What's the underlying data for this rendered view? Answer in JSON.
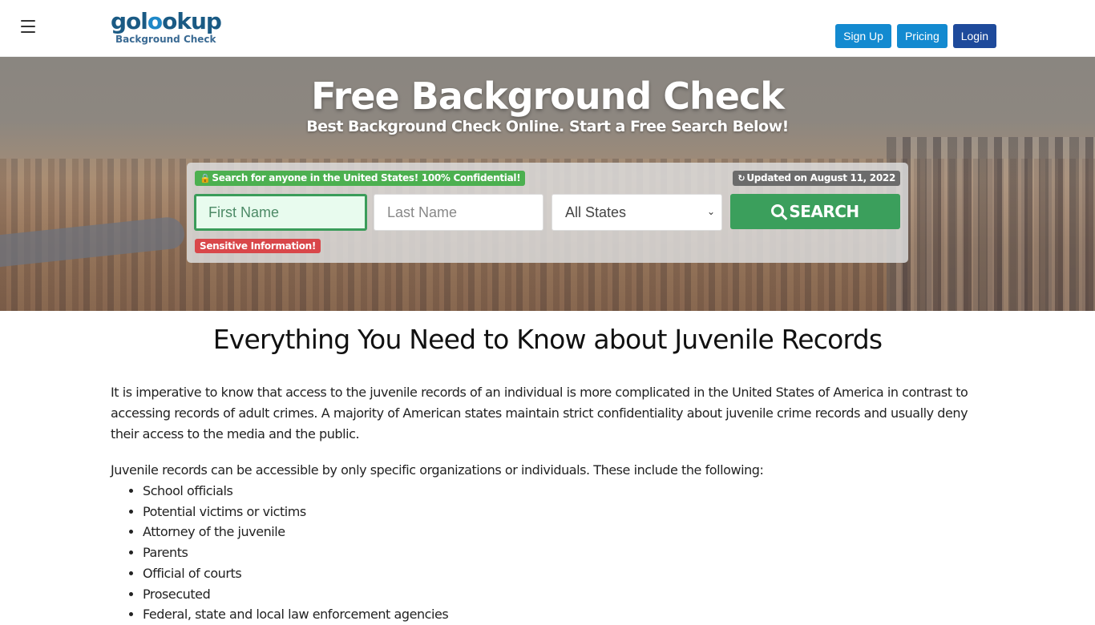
{
  "header": {
    "menu_icon": "hamburger-menu-icon",
    "logo": {
      "main_prefix": "gol",
      "main_accent": "o",
      "main_suffix": "okup",
      "sub": "Background Check"
    },
    "nav": {
      "signup": "Sign Up",
      "pricing": "Pricing",
      "login": "Login"
    },
    "colors": {
      "signup": "#138ad0",
      "pricing": "#138ad0",
      "login": "#1e4a9b"
    }
  },
  "hero": {
    "title": "Free Background Check",
    "subtitle": "Best Background Check Online. Start a Free Search Below!",
    "search": {
      "confidential_badge": "Search for anyone in the United States! 100% Confidential!",
      "confidential_icon": "lock-icon",
      "updated_badge": "Updated on August 11, 2022",
      "updated_icon": "refresh-icon",
      "first_name": {
        "value": "",
        "placeholder": "First Name"
      },
      "last_name": {
        "value": "",
        "placeholder": "Last Name"
      },
      "state": {
        "selected": "All States"
      },
      "search_button": "SEARCH",
      "search_icon": "search-icon",
      "sensitive_badge": "Sensitive Information!"
    }
  },
  "article": {
    "title": "Everything You Need to Know about Juvenile Records",
    "paragraphs": [
      "It is imperative to know that access to the juvenile records of an individual is more complicated in the United States of America in contrast to accessing records of adult crimes. A majority of American states maintain strict confidentiality about juvenile crime records and usually deny their access to the media and the public.",
      "Juvenile records can be accessible by only specific organizations or individuals. These include the following:"
    ],
    "list": [
      "School officials",
      "Potential victims or victims",
      "Attorney of the juvenile",
      "Parents",
      "Official of courts",
      "Prosecuted",
      "Federal, state and local law enforcement agencies"
    ]
  }
}
